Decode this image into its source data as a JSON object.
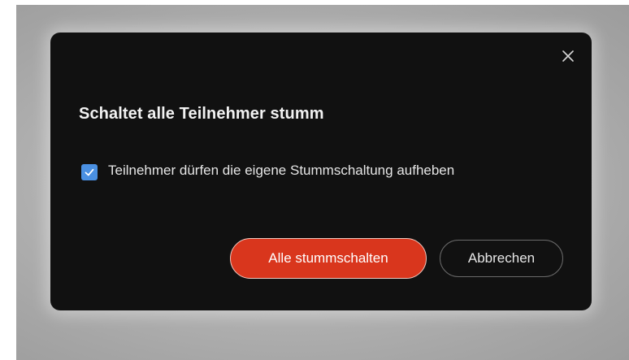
{
  "dialog": {
    "title": "Schaltet alle Teilnehmer stumm",
    "checkbox": {
      "label": "Teilnehmer dürfen die eigene Stummschaltung aufheben",
      "checked": true
    },
    "primary_button": "Alle stummschalten",
    "secondary_button": "Abbrechen",
    "close_icon": "close-icon"
  },
  "colors": {
    "dialog_bg": "#111111",
    "checkbox_accent": "#4a90e2",
    "primary_button_bg": "#d9361d"
  }
}
